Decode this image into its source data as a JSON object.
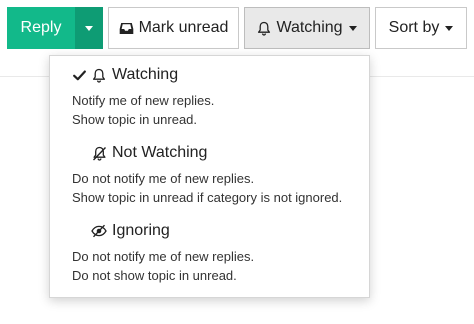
{
  "toolbar": {
    "reply_label": "Reply",
    "mark_unread_label": "Mark unread",
    "watching_label": "Watching",
    "sort_label": "Sort by"
  },
  "dropdown": {
    "options": [
      {
        "title": "Watching",
        "selected": true,
        "icon": "bell-icon",
        "desc": [
          "Notify me of new replies.",
          "Show topic in unread."
        ]
      },
      {
        "title": "Not Watching",
        "selected": false,
        "icon": "bell-slash-icon",
        "desc": [
          "Do not notify me of new replies.",
          "Show topic in unread if category is not ignored."
        ]
      },
      {
        "title": "Ignoring",
        "selected": false,
        "icon": "eye-slash-icon",
        "desc": [
          "Do not notify me of new replies.",
          "Do not show topic in unread."
        ]
      }
    ]
  },
  "colors": {
    "primary": "#12b98a",
    "primary_dark": "#0e9c74",
    "active_button_bg": "#e9e9e9"
  }
}
